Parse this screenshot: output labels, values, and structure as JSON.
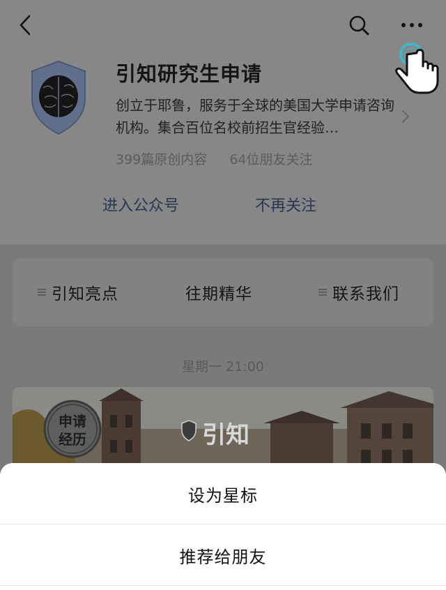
{
  "account": {
    "name": "引知研究生申请",
    "description": "创立于耶鲁，服务于全球的美国大学申请咨询机构。集合百位名校前招生官经验…",
    "articles": "399篇原创内容",
    "followers": "64位朋友关注"
  },
  "actions": {
    "enter": "进入公众号",
    "unfollow": "不再关注"
  },
  "menu": {
    "items": [
      {
        "label": "引知亮点",
        "has_icon": true
      },
      {
        "label": "往期精华",
        "has_icon": false
      },
      {
        "label": "联系我们",
        "has_icon": true
      }
    ]
  },
  "feed": {
    "timestamp": "星期一 21:00",
    "cover": {
      "badge_line1": "申请",
      "badge_line2": "经历",
      "logo_text": "引知"
    }
  },
  "sheet": {
    "star": "设为星标",
    "recommend": "推荐给朋友"
  },
  "icons": {
    "back": "chevron-left-icon",
    "search": "search-icon",
    "more": "more-dots-icon",
    "pointer": "pointer-hand-icon"
  },
  "colors": {
    "overlay_dimmed_bg": "#7b7b7b",
    "link": "#2a3552",
    "sheet_bg": "#ffffff",
    "hand_highlight": "#3fb5c6"
  }
}
